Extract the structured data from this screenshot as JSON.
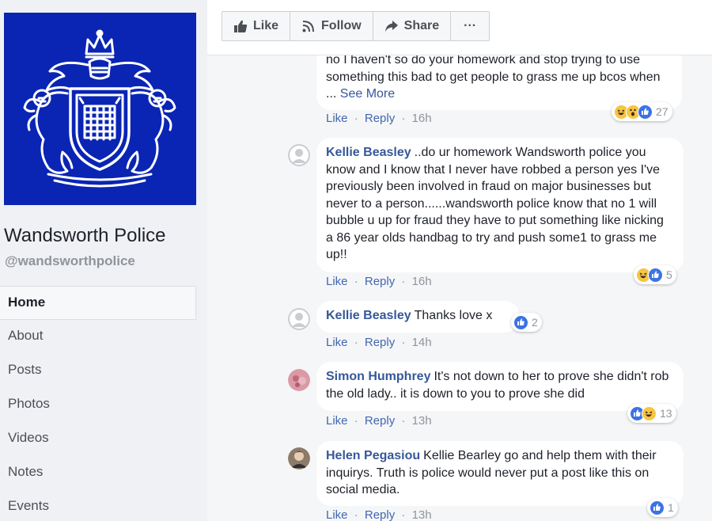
{
  "sidebar": {
    "page_name": "Wandsworth Police",
    "page_handle": "@wandsworthpolice",
    "nav": [
      "Home",
      "About",
      "Posts",
      "Photos",
      "Videos",
      "Notes",
      "Events"
    ],
    "active_nav": "Home",
    "cover_color": "#0a25b3"
  },
  "actions": {
    "like": "Like",
    "follow": "Follow",
    "share": "Share",
    "more": "···"
  },
  "comments": [
    {
      "author": "",
      "text": "no I haven't so do your homework and stop trying to use something this bad to get people to grass me up bcos when ... ",
      "see_more": "See More",
      "like": "Like",
      "reply": "Reply",
      "time": "16h",
      "reactions": [
        "haha",
        "wow",
        "like"
      ],
      "reaction_count": "27"
    },
    {
      "author": "Kellie Beasley",
      "text": "..do ur homework Wandsworth police you know and I know that I never have robbed a person yes I've previously been involved in fraud on major businesses but never to a person......wandsworth police know that no 1 will bubble u up for fraud they have to put something like nicking a 86 year olds handbag to try and push some1 to grass me up!!",
      "like": "Like",
      "reply": "Reply",
      "time": "16h",
      "reactions": [
        "haha",
        "like"
      ],
      "reaction_count": "5"
    },
    {
      "author": "Kellie Beasley",
      "text": "Thanks love x",
      "like": "Like",
      "reply": "Reply",
      "time": "14h",
      "reactions": [
        "like"
      ],
      "reaction_count": "2"
    },
    {
      "author": "Simon Humphrey",
      "text": "It's not down to her to prove she didn't rob the old lady.. it is down to you to prove she did",
      "like": "Like",
      "reply": "Reply",
      "time": "13h",
      "reactions": [
        "like",
        "haha"
      ],
      "reaction_count": "13"
    },
    {
      "author": "Helen Pegasiou",
      "text": "Kellie Bearley go and help them with their inquirys. Truth is police would never put a post like this on social media.",
      "like": "Like",
      "reply": "Reply",
      "time": "13h",
      "reactions": [
        "like"
      ],
      "reaction_count": "1"
    }
  ],
  "meta_separator": "·",
  "colors": {
    "link": "#365899",
    "action_link": "#4267b2",
    "muted": "#90949c",
    "like_blue": "#3b73e6",
    "emoji_yellow": "#f7c541"
  }
}
